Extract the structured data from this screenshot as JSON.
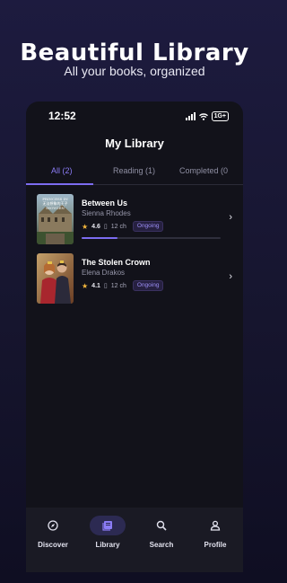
{
  "promo": {
    "title": "Beautiful Library",
    "subtitle": "All your books, organized"
  },
  "status_bar": {
    "time": "12:52",
    "network": "1G+"
  },
  "header": {
    "title": "My Library"
  },
  "tabs": [
    {
      "label": "All (2)",
      "active": true
    },
    {
      "label": "Reading (1)",
      "active": false
    },
    {
      "label": "Completed (0",
      "active": false
    }
  ],
  "books": [
    {
      "title": "Between Us",
      "author": "Sienna Rhodes",
      "rating": "4.6",
      "chapters": "12 ch",
      "status": "Ongoing",
      "progress": 0.26,
      "cover_text": "PRINCESS IN\n无法想象的王子\nINOVGEN"
    },
    {
      "title": "The Stolen Crown",
      "author": "Elena Drakos",
      "rating": "4.1",
      "chapters": "12 ch",
      "status": "Ongoing"
    }
  ],
  "bottom_nav": [
    {
      "label": "Discover",
      "icon": "compass-icon",
      "active": false
    },
    {
      "label": "Library",
      "icon": "book-icon",
      "active": true
    },
    {
      "label": "Search",
      "icon": "search-icon",
      "active": false
    },
    {
      "label": "Profile",
      "icon": "person-icon",
      "active": false
    }
  ],
  "colors": {
    "accent": "#7c6cf0",
    "background": "#12121a",
    "star": "#f3b63c"
  }
}
